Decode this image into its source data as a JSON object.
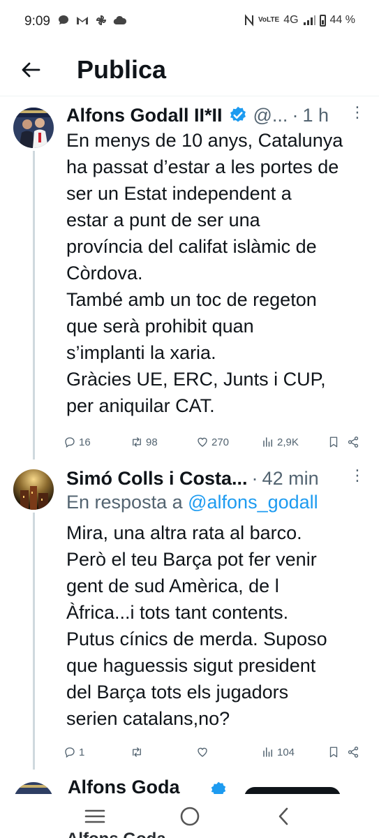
{
  "status_bar": {
    "time": "9:09",
    "network": "4G",
    "volte": "VoLTE",
    "battery": "44 %"
  },
  "header": {
    "title": "Publica"
  },
  "posts": [
    {
      "name": "Alfons Godall II*II",
      "handle": "@...",
      "time": "1 h",
      "text": "En menys de 10 anys, Catalunya\nha passat d’estar a les portes de\nser un Estat independent a\nestar a punt de ser una\nprovíncia del califat islàmic de\nCòrdova.\nTambé amb un toc de regeton\nque serà prohibit quan\ns’implanti la xaria.\nGràcies UE, ERC, Junts i CUP,\nper aniquilar CAT.",
      "replies": "16",
      "reposts": "98",
      "likes": "270",
      "views": "2,9K"
    },
    {
      "name": "Simó  Colls i Costa...",
      "time": "42 min",
      "reply_prefix": "En resposta a ",
      "reply_handle": "@alfons_godall",
      "text": "Mira, una altra rata al barco.\nPerò el teu Barça pot fer venir\ngent de sud Amèrica, de l\nÀfrica...i tots tant contents.\nPutus cínics de merda. Suposo\nque haguessis sigut president\ndel Barça tots els jugadors\nserien catalans,no?",
      "replies": "1",
      "reposts": "",
      "likes": "",
      "views": "104"
    }
  ],
  "peek_post": {
    "name": "Alfons Goda"
  },
  "peek_bottom": {
    "name": "Alfons Goda"
  },
  "colors": {
    "accent": "#1d9bf0",
    "text": "#0f1419",
    "muted": "#536471",
    "thread_line": "#cfd9de"
  }
}
